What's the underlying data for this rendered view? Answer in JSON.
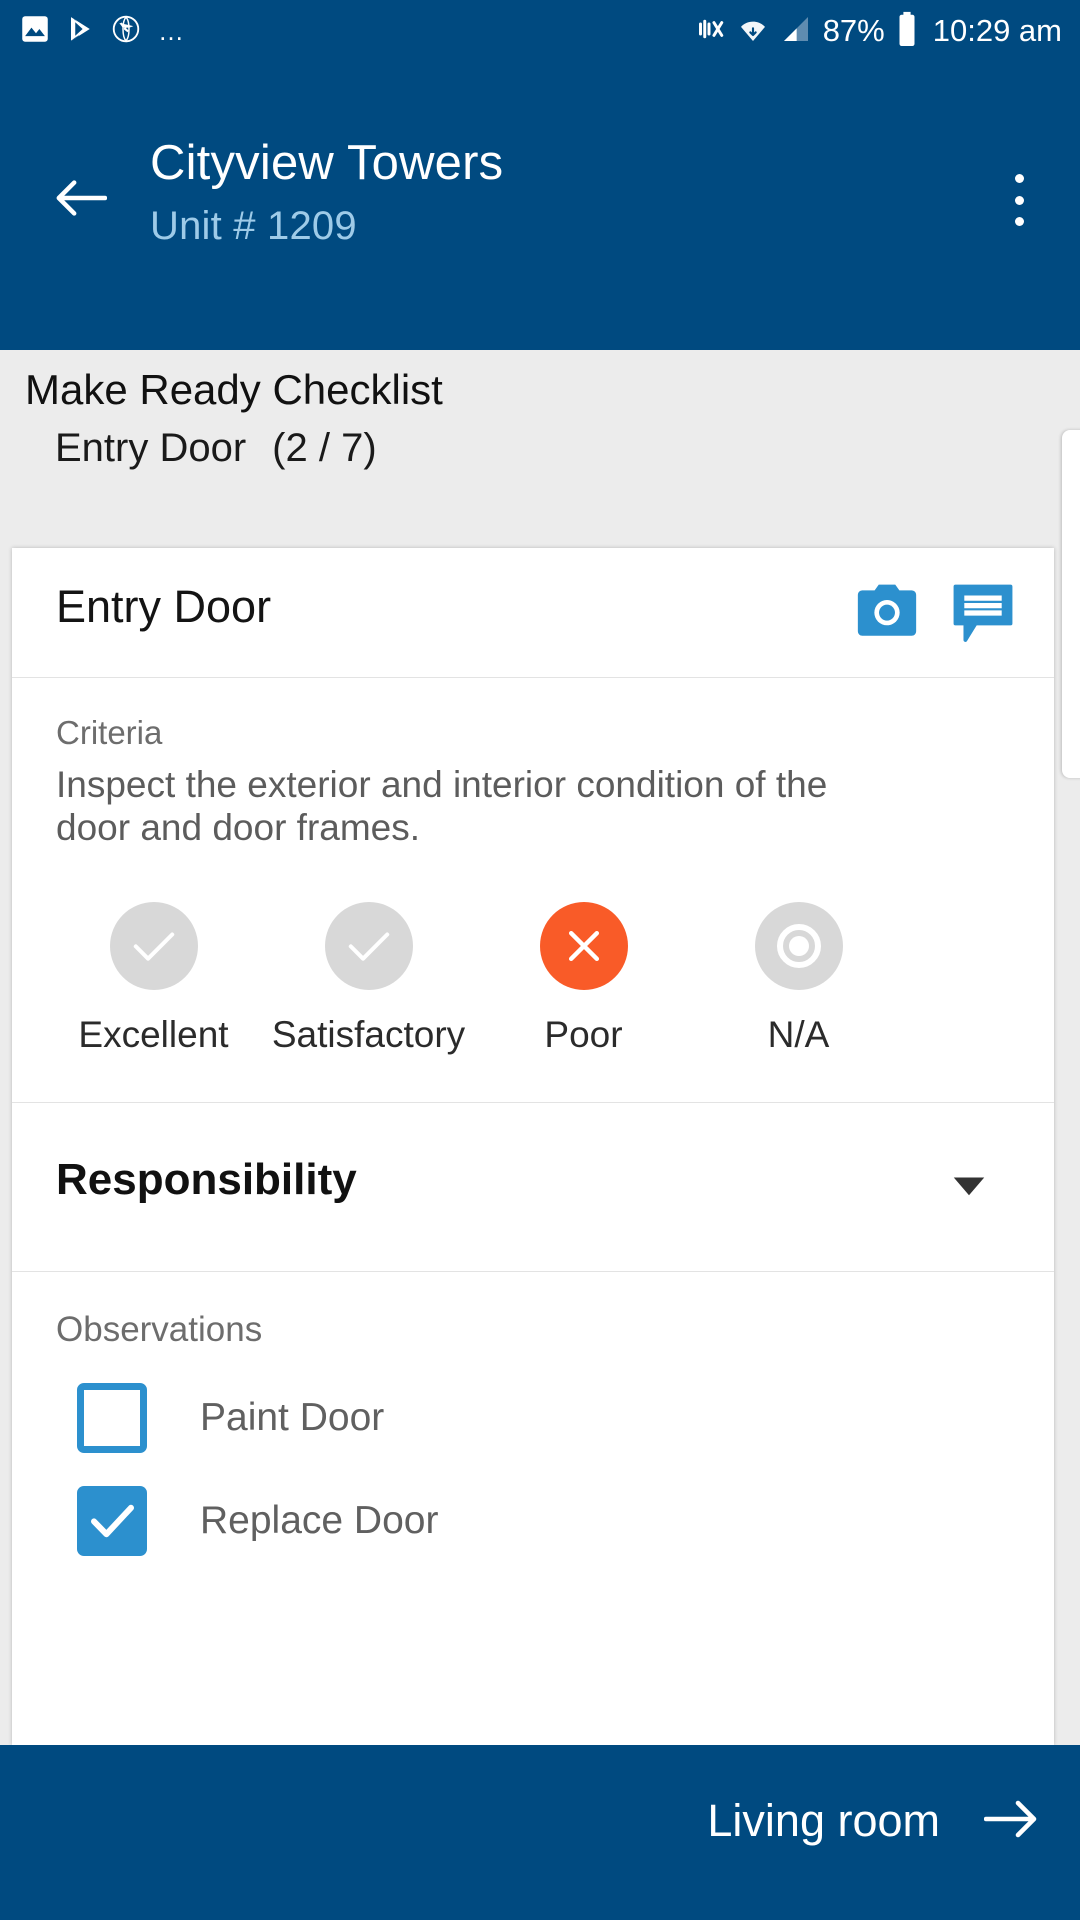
{
  "statusbar": {
    "left_icons": [
      "image-icon",
      "play-store-icon",
      "globe-icon"
    ],
    "overflow": "…",
    "mute_icon": "vibrate-mute-icon",
    "wifi_icon": "wifi-icon",
    "signal_icon": "cellular-signal-icon",
    "battery_percent": "87%",
    "battery_icon": "battery-icon",
    "time": "10:29 am"
  },
  "appbar": {
    "back_icon": "back-arrow-icon",
    "title": "Cityview Towers",
    "subtitle": "Unit # 1209",
    "menu_icon": "overflow-menu-icon"
  },
  "subheader": {
    "title": "Make Ready Checklist",
    "section": "Entry Door",
    "progress": "(2 / 7)"
  },
  "card": {
    "title": "Entry Door",
    "camera_icon": "camera-icon",
    "comment_icon": "comment-icon",
    "criteria": {
      "label": "Criteria",
      "text": "Inspect the exterior and interior condition of the door and door frames."
    },
    "ratings": [
      {
        "label": "Excellent",
        "icon": "check-icon",
        "selected": false
      },
      {
        "label": "Satisfactory",
        "icon": "check-icon",
        "selected": false
      },
      {
        "label": "Poor",
        "icon": "close-icon",
        "selected": true
      },
      {
        "label": "N/A",
        "icon": "circle-ring-icon",
        "selected": false
      }
    ],
    "responsibility": {
      "label": "Responsibility",
      "caret_icon": "chevron-down-icon",
      "value": ""
    },
    "observations": {
      "label": "Observations",
      "items": [
        {
          "label": "Paint Door",
          "checked": false
        },
        {
          "label": "Replace Door",
          "checked": true
        }
      ]
    }
  },
  "bottombar": {
    "next_label": "Living room",
    "next_icon": "forward-arrow-icon"
  },
  "colors": {
    "brand_blue": "#004A80",
    "accent_blue": "#2C90CE",
    "selected_orange": "#F95B28",
    "page_gray": "#ECECEC",
    "subtitle_blue": "#9ECBE8"
  }
}
